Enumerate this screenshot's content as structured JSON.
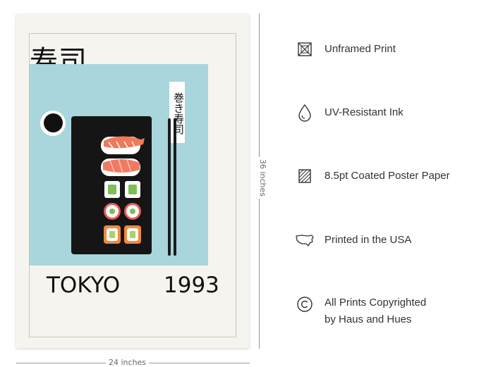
{
  "poster": {
    "kanji_title": "寿司",
    "vertical_label": "巻き寿司",
    "city": "TOKYO",
    "year": "1993"
  },
  "dimensions": {
    "height_label": "36 inches",
    "width_label": "24 inches"
  },
  "features": [
    {
      "icon": "unframed-icon",
      "label": "Unframed Print"
    },
    {
      "icon": "droplet-icon",
      "label": "UV-Resistant Ink"
    },
    {
      "icon": "paper-icon",
      "label": "8.5pt Coated Poster Paper"
    },
    {
      "icon": "usa-map-icon",
      "label": "Printed in the USA"
    },
    {
      "icon": "copyright-icon",
      "label_line1": "All Prints Copyrighted",
      "label_line2": "by Haus and Hues"
    }
  ],
  "colors": {
    "poster_bg": "#f6f4ef",
    "panel_blue": "#a9d5dc",
    "text_dark": "#111111",
    "salmon": "#f07a5a"
  }
}
